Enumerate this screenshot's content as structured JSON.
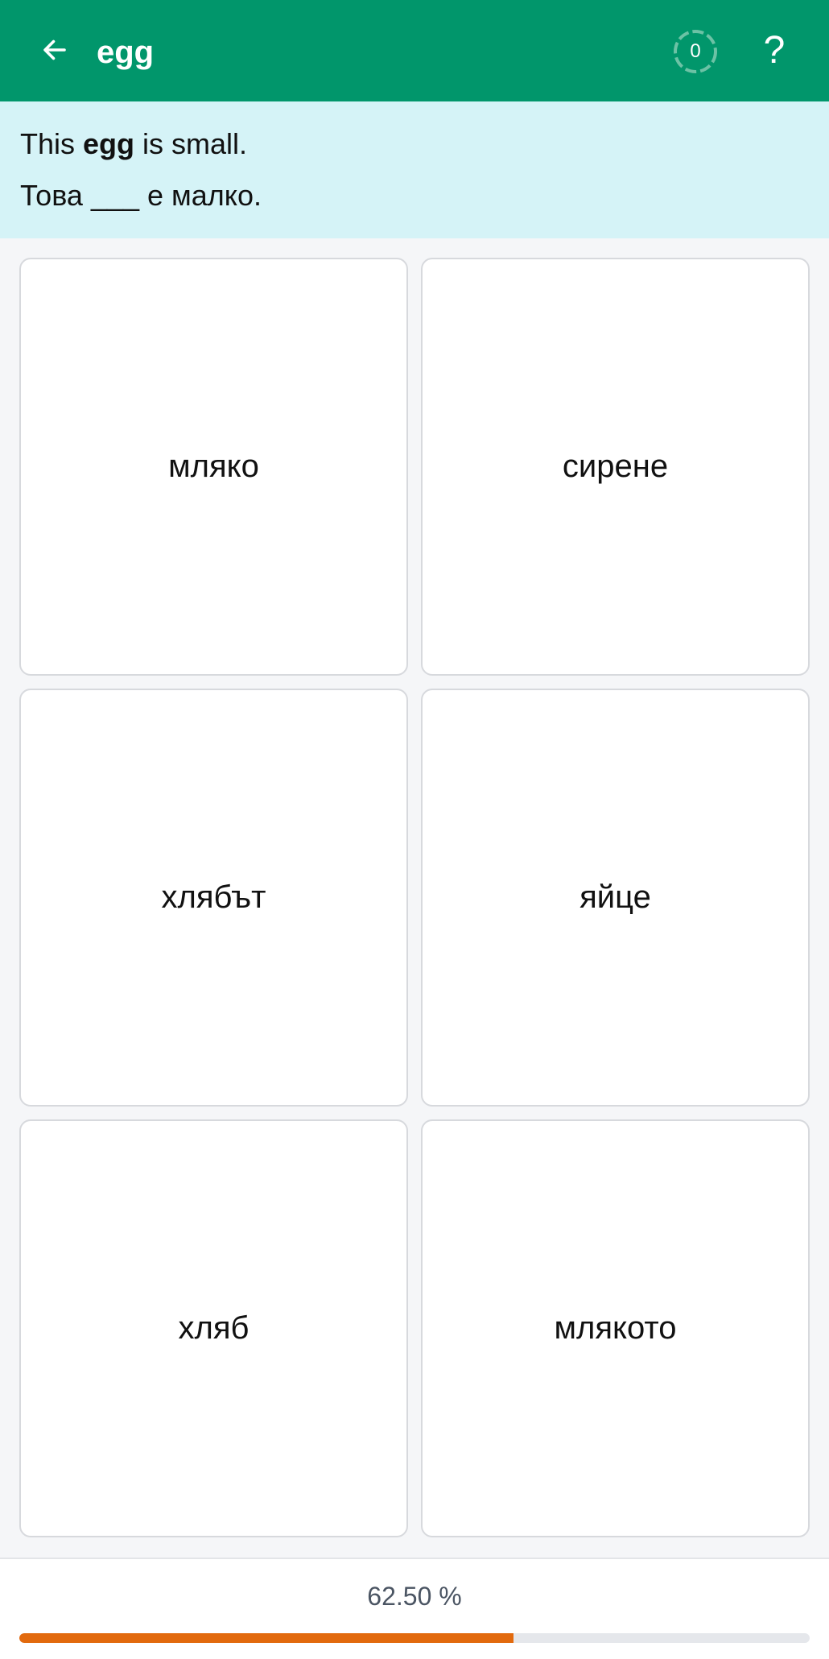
{
  "header": {
    "title": "egg",
    "score": "0",
    "help_label": "?",
    "back_icon": "arrow-left-icon",
    "background_color": "#01966b"
  },
  "prompt": {
    "english_before": "This ",
    "english_word": "egg",
    "english_after": " is small.",
    "bulgarian": "Това ___ е малко.",
    "background_color": "#d5f3f7"
  },
  "options": [
    {
      "label": "мляко"
    },
    {
      "label": "сирене"
    },
    {
      "label": "хлябът"
    },
    {
      "label": "яйце"
    },
    {
      "label": "хляб"
    },
    {
      "label": "млякото"
    }
  ],
  "progress": {
    "text": "62.50 %",
    "fraction": 0.625,
    "fill_color": "#e26a0e"
  }
}
